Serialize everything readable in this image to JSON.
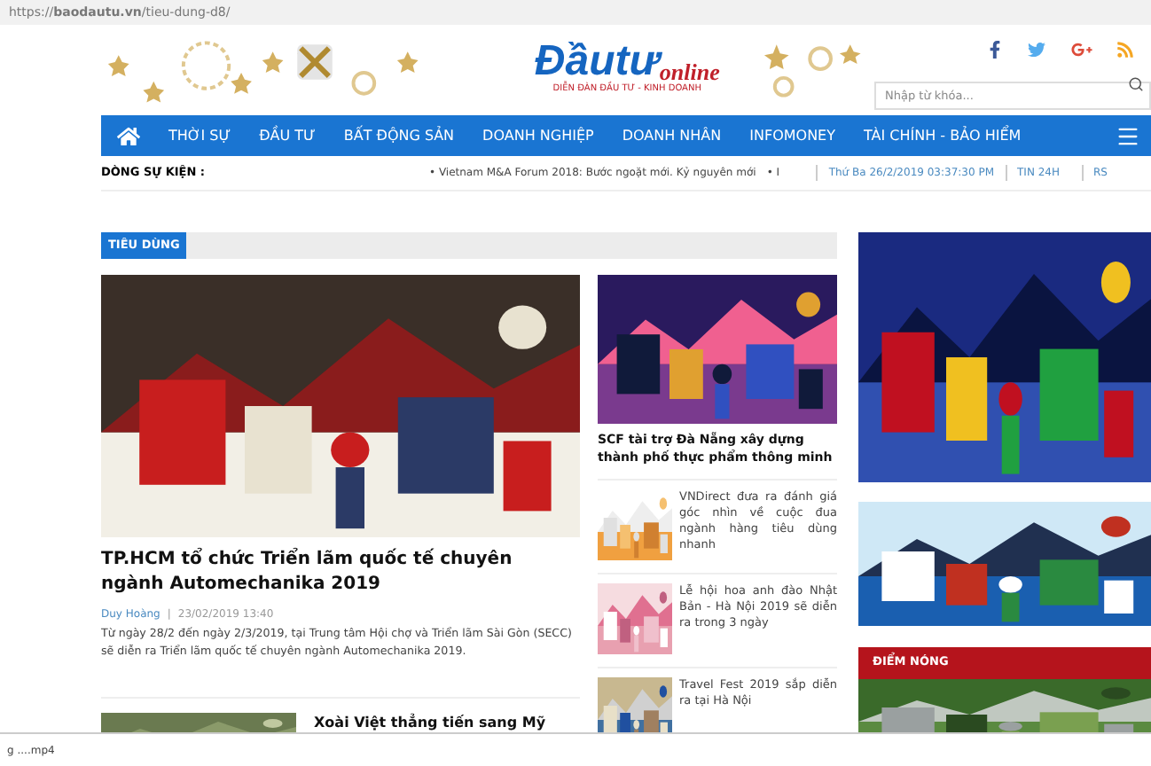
{
  "address_bar": {
    "url": "https://**baodautu.vn**/tieu-dung-d8/"
  },
  "header": {
    "logo": {
      "main": "Đầutư",
      "sub": "online",
      "tagline": "DIỄN ĐÀN ĐẦU TƯ - KINH DOANH"
    },
    "search": {
      "placeholder": "Nhập từ khóa..."
    }
  },
  "nav": {
    "items": [
      {
        "label": "THỜI SỰ"
      },
      {
        "label": "ĐẦU TƯ"
      },
      {
        "label": "BẤT ĐỘNG SẢN"
      },
      {
        "label": "DOANH NGHIỆP"
      },
      {
        "label": "DOANH NHÂN"
      },
      {
        "label": "INFOMONEY"
      },
      {
        "label": "TÀI CHÍNH - BẢO HIỂM"
      }
    ]
  },
  "ticker": {
    "label": "DÒNG SỰ KIỆN :",
    "headline": "• Vietnam M&A Forum 2018: Bước ngoặt mới. Kỷ nguyên mới",
    "more": "• I",
    "date": "Thứ Ba 26/2/2019 03:37:30 PM",
    "links": [
      "TIN 24H",
      "RS"
    ]
  },
  "section": {
    "title": "TIÊU DÙNG",
    "lead": {
      "title": "TP.HCM tổ chức Triển lãm quốc tế chuyên ngành Automechanika 2019",
      "author": "Duy Hoàng",
      "separator": "|",
      "date": "23/02/2019 13:40",
      "summary": "Từ ngày 28/2 đến ngày 2/3/2019, tại Trung tâm Hội chợ và Triển lãm Sài Gòn (SECC) sẽ diễn ra Triển lãm quốc tế chuyên ngành Automechanika 2019."
    },
    "feature": {
      "title": "SCF tài trợ Đà Nẵng xây dựng thành phố thực phẩm thông minh"
    },
    "list": [
      {
        "title": "VNDirect đưa ra đánh giá góc nhìn về cuộc đua ngành hàng tiêu dùng nhanh"
      },
      {
        "title": "Lễ hội hoa anh đào Nhật Bản - Hà Nội 2019 sẽ diễn ra trong 3 ngày"
      },
      {
        "title": "Travel Fest 2019 sắp diễn ra tại Hà Nội"
      }
    ],
    "next": {
      "title": "Xoài Việt thẳng tiến sang Mỹ"
    }
  },
  "sidebar": {
    "hot": {
      "title": "ĐIỂM NÓNG"
    }
  },
  "download_bar": {
    "file": "g ....mp4"
  }
}
